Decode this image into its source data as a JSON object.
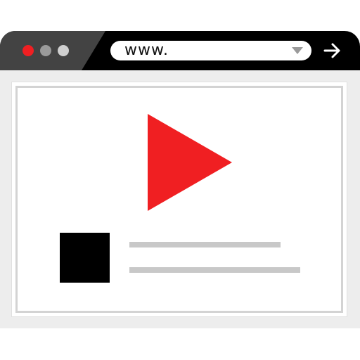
{
  "window": {
    "controls": [
      {
        "name": "close",
        "color": "#f01f22"
      },
      {
        "name": "minimize",
        "color": "#9a9a9a"
      },
      {
        "name": "maximize",
        "color": "#cfcfcf"
      }
    ],
    "address_bar": {
      "value": "www.",
      "dropdown_icon": "caret-down-icon"
    },
    "go_icon": "arrow-right-icon"
  },
  "content": {
    "play_icon": "play-icon",
    "play_color": "#f01f22",
    "thumbnail_color": "#000000",
    "text_line_color": "#c8c8c8"
  }
}
